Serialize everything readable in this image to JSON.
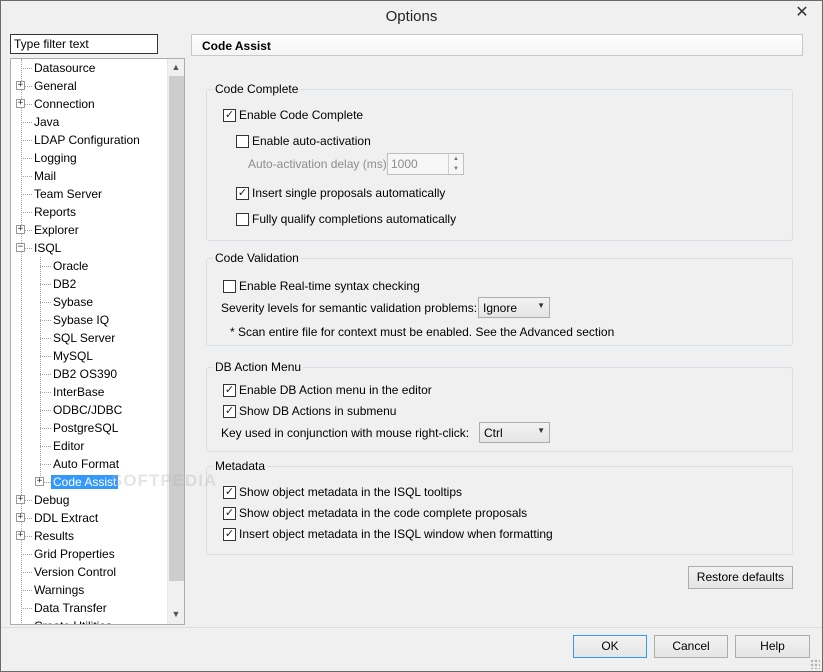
{
  "window": {
    "title": "Options",
    "close_glyph": "✕"
  },
  "filter": {
    "placeholder": "Type filter text"
  },
  "tree": {
    "items": [
      {
        "label": "Datasource",
        "level": 0,
        "expander": null
      },
      {
        "label": "General",
        "level": 0,
        "expander": "+"
      },
      {
        "label": "Connection",
        "level": 0,
        "expander": "+"
      },
      {
        "label": "Java",
        "level": 0,
        "expander": null
      },
      {
        "label": "LDAP Configuration",
        "level": 0,
        "expander": null
      },
      {
        "label": "Logging",
        "level": 0,
        "expander": null
      },
      {
        "label": "Mail",
        "level": 0,
        "expander": null
      },
      {
        "label": "Team Server",
        "level": 0,
        "expander": null
      },
      {
        "label": "Reports",
        "level": 0,
        "expander": null
      },
      {
        "label": "Explorer",
        "level": 0,
        "expander": "+"
      },
      {
        "label": "ISQL",
        "level": 0,
        "expander": "-"
      },
      {
        "label": "Oracle",
        "level": 1,
        "expander": null
      },
      {
        "label": "DB2",
        "level": 1,
        "expander": null
      },
      {
        "label": "Sybase",
        "level": 1,
        "expander": null
      },
      {
        "label": "Sybase IQ",
        "level": 1,
        "expander": null
      },
      {
        "label": "SQL Server",
        "level": 1,
        "expander": null
      },
      {
        "label": "MySQL",
        "level": 1,
        "expander": null
      },
      {
        "label": "DB2 OS390",
        "level": 1,
        "expander": null
      },
      {
        "label": "InterBase",
        "level": 1,
        "expander": null
      },
      {
        "label": "ODBC/JDBC",
        "level": 1,
        "expander": null
      },
      {
        "label": "PostgreSQL",
        "level": 1,
        "expander": null
      },
      {
        "label": "Editor",
        "level": 1,
        "expander": null
      },
      {
        "label": "Auto Format",
        "level": 1,
        "expander": null
      },
      {
        "label": "Code Assist",
        "level": 1,
        "expander": "+",
        "selected": true
      },
      {
        "label": "Debug",
        "level": 0,
        "expander": "+"
      },
      {
        "label": "DDL Extract",
        "level": 0,
        "expander": "+"
      },
      {
        "label": "Results",
        "level": 0,
        "expander": "+"
      },
      {
        "label": "Grid Properties",
        "level": 0,
        "expander": null
      },
      {
        "label": "Version Control",
        "level": 0,
        "expander": null
      },
      {
        "label": "Warnings",
        "level": 0,
        "expander": null
      },
      {
        "label": "Data Transfer",
        "level": 0,
        "expander": null
      },
      {
        "label": "Create Utilities",
        "level": 0,
        "expander": null
      }
    ]
  },
  "header": {
    "title": "Code Assist"
  },
  "code_complete": {
    "title": "Code Complete",
    "enable_label": "Enable Code Complete",
    "enable_checked": true,
    "auto_activation_label": "Enable auto-activation",
    "auto_activation_checked": false,
    "delay_label": "Auto-activation delay (ms):",
    "delay_value": "1000",
    "single_proposals_label": "Insert single proposals automatically",
    "single_proposals_checked": true,
    "fully_qualify_label": "Fully qualify completions automatically",
    "fully_qualify_checked": false
  },
  "code_validation": {
    "title": "Code Validation",
    "realtime_label": "Enable Real-time syntax checking",
    "realtime_checked": false,
    "severity_label": "Severity levels for semantic validation problems:",
    "severity_value": "Ignore",
    "note": "* Scan entire file for context must be enabled. See the Advanced section"
  },
  "db_action_menu": {
    "title": "DB Action Menu",
    "enable_label": "Enable DB Action menu in the editor",
    "enable_checked": true,
    "submenu_label": "Show DB Actions in submenu",
    "submenu_checked": true,
    "key_label": "Key used in conjunction with mouse right-click:",
    "key_value": "Ctrl"
  },
  "metadata": {
    "title": "Metadata",
    "tooltips_label": "Show object metadata in the ISQL tooltips",
    "tooltips_checked": true,
    "proposals_label": "Show object metadata in the code complete proposals",
    "proposals_checked": true,
    "insert_label": "Insert object metadata in the ISQL window when formatting",
    "insert_checked": true
  },
  "buttons": {
    "restore_defaults": "Restore defaults",
    "ok": "OK",
    "cancel": "Cancel",
    "help": "Help"
  },
  "watermark": "SOFTPEDIA"
}
